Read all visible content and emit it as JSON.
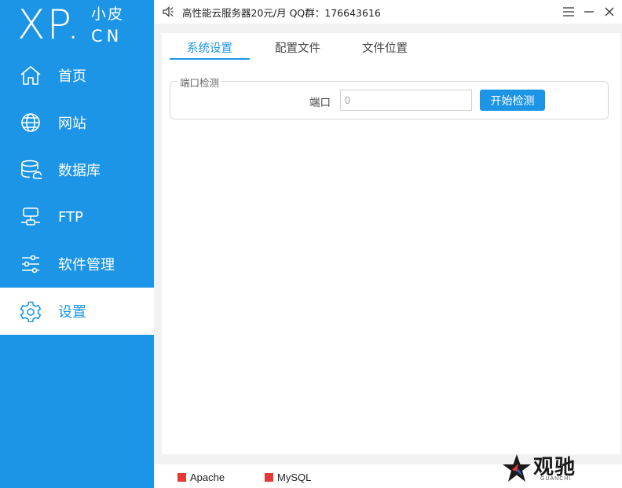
{
  "logo": {
    "main": "XP.",
    "small": "小皮",
    "cn": "CN"
  },
  "sidebar": {
    "items": [
      {
        "label": "首页",
        "icon": "home-icon"
      },
      {
        "label": "网站",
        "icon": "globe-icon"
      },
      {
        "label": "数据库",
        "icon": "database-icon"
      },
      {
        "label": "FTP",
        "icon": "ftp-icon"
      },
      {
        "label": "软件管理",
        "icon": "sliders-icon"
      },
      {
        "label": "设置",
        "icon": "gear-icon",
        "active": true
      }
    ]
  },
  "topbar": {
    "notice": "高性能云服务器20元/月  QQ群：176643616"
  },
  "tabs": [
    {
      "label": "系统设置",
      "active": true
    },
    {
      "label": "配置文件"
    },
    {
      "label": "文件位置"
    }
  ],
  "port_check": {
    "group_title": "端口检测",
    "port_label": "端口",
    "port_value": "0",
    "button_label": "开始检测"
  },
  "status": [
    {
      "label": "Apache",
      "color": "#e53935"
    },
    {
      "label": "MySQL",
      "color": "#e53935"
    }
  ],
  "watermark": {
    "text": "观驰",
    "sub": "GUANCHI"
  },
  "colors": {
    "accent": "#1c95e6",
    "status_stopped": "#e53935"
  }
}
